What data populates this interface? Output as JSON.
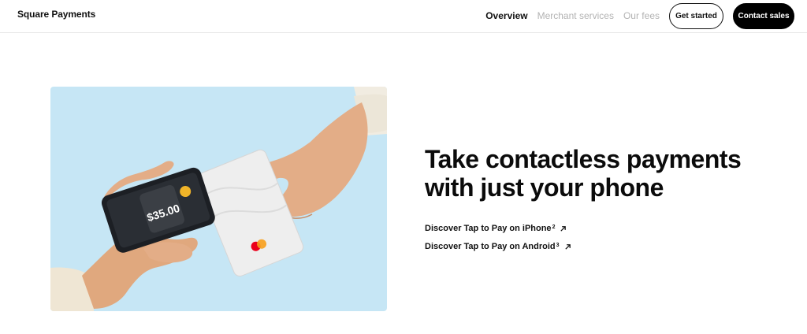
{
  "header": {
    "brand": "Square Payments",
    "nav": [
      {
        "label": "Overview"
      },
      {
        "label": "Merchant services"
      },
      {
        "label": "Our fees"
      }
    ],
    "cta_primary": "Get started",
    "cta_secondary": "Contact sales"
  },
  "hero": {
    "title_line1": "Take contactless payments",
    "title_line2": "with just your phone",
    "links": [
      {
        "label": "Discover Tap to Pay on iPhone",
        "sup": "2",
        "icon": "arrow-up-right-icon"
      },
      {
        "label": "Discover Tap to Pay on Android",
        "sup": "3",
        "icon": "arrow-up-right-icon"
      }
    ],
    "image": {
      "phone_amount": "$35.00",
      "background_color": "#c6e6f5"
    }
  },
  "colors": {
    "text": "#111111",
    "muted_nav": "#b3b3b3",
    "button_dark": "#000000",
    "divider": "#e6e6e6"
  }
}
